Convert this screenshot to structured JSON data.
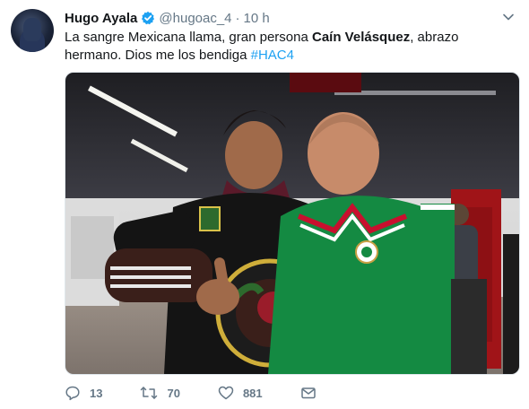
{
  "tweet": {
    "author_name": "Hugo Ayala",
    "handle": "@hugoac_4",
    "separator": "·",
    "time": "10 h",
    "text_part1": "La sangre Mexicana llama, gran persona ",
    "text_bold": "Caín Velásquez",
    "text_part2": ", abrazo hermano. Dios me los bendiga ",
    "hashtag": "#HAC4"
  },
  "actions": {
    "reply_count": "13",
    "retweet_count": "70",
    "like_count": "881"
  },
  "colors": {
    "link": "#1da1f2",
    "muted": "#657786",
    "verified": "#1da1f2"
  },
  "icons": [
    "avatar",
    "verified-badge-icon",
    "chevron-down-icon",
    "reply-icon",
    "retweet-icon",
    "like-icon",
    "message-icon"
  ]
}
